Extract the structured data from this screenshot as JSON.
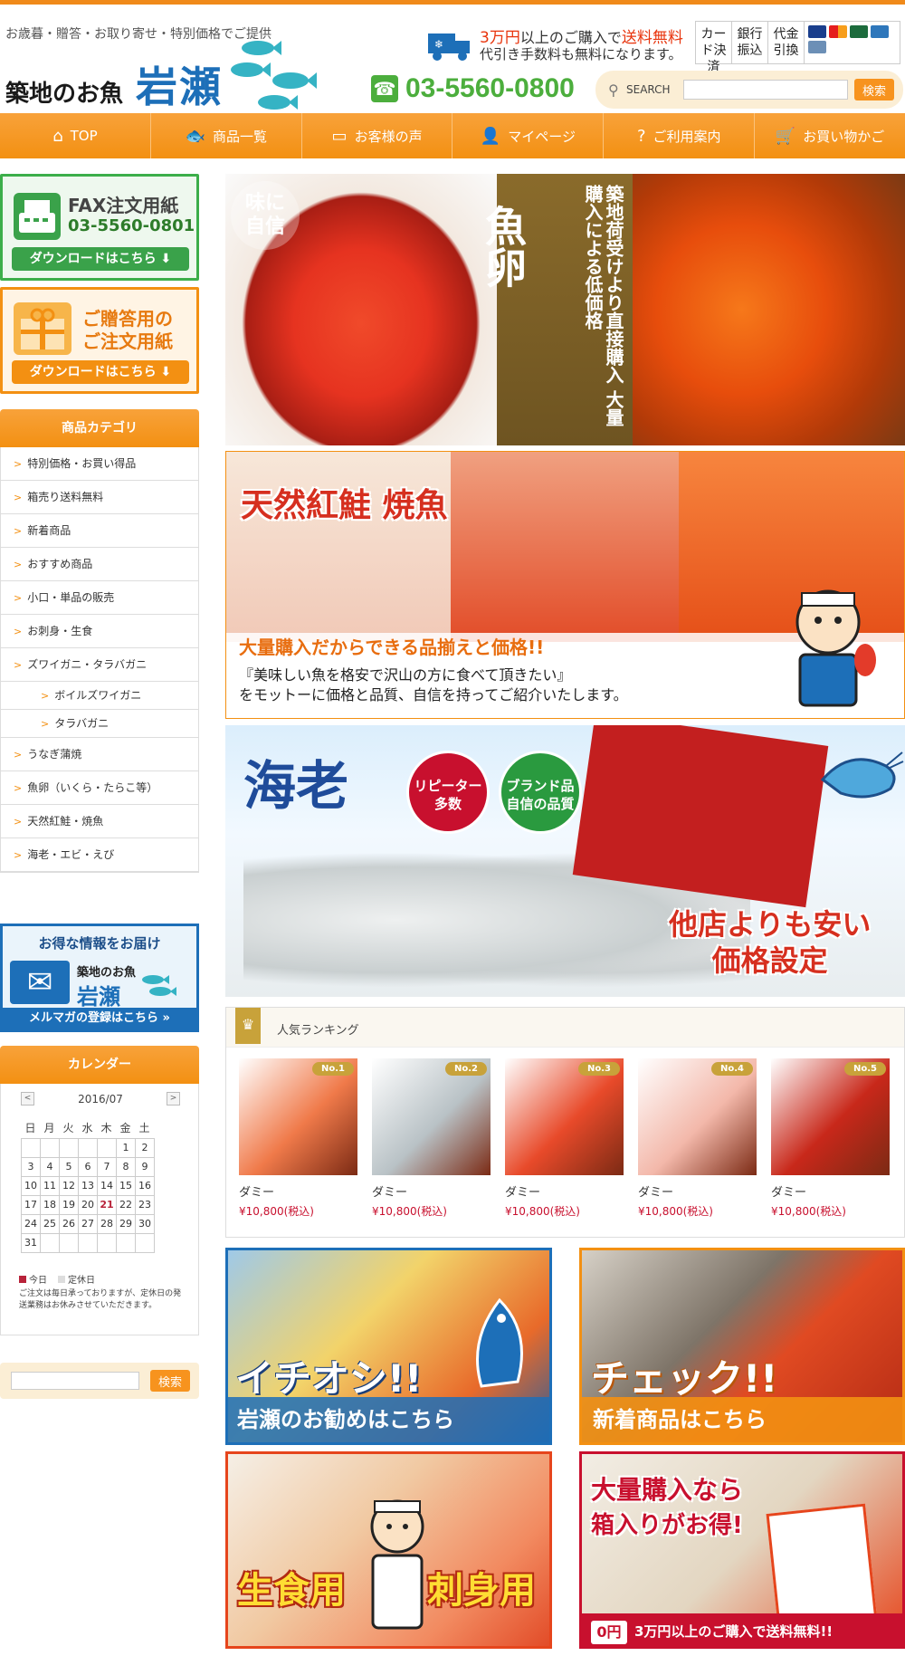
{
  "header": {
    "tagline": "お歳暮・贈答・お取り寄せ・特別価格でご提供",
    "logo_small": "築地のお魚",
    "logo_big": "岩瀬",
    "shipping_amount": "3万円",
    "shipping_mid": "以上のご購入で",
    "shipping_free": "送料無料",
    "shipping_line2": "代引き手数料も無料になります。",
    "payment": [
      "カード決済",
      "銀行振込",
      "代金引換"
    ],
    "phone": "03-5560-0800",
    "search_label": "SEARCH",
    "search_placeholder": "",
    "search_button": "検索"
  },
  "nav": [
    {
      "label": "TOP",
      "icon": "⌂"
    },
    {
      "label": "商品一覧",
      "icon": "🐟"
    },
    {
      "label": "お客様の声",
      "icon": "▭"
    },
    {
      "label": "マイページ",
      "icon": "👤"
    },
    {
      "label": "ご利用案内",
      "icon": "?"
    },
    {
      "label": "お買い物かご",
      "icon": "🛒"
    }
  ],
  "sidebar": {
    "fax_title": "FAX注文用紙",
    "fax_number": "03-5560-0801",
    "fax_download": "ダウンロードはこちら ⬇",
    "gift_title_1": "ご贈答用の",
    "gift_title_2": "ご注文用紙",
    "gift_download": "ダウンロードはこちら ⬇",
    "category_heading": "商品カテゴリ",
    "categories": [
      "特別価格・お買い得品",
      "箱売り送料無料",
      "新着商品",
      "おすすめ商品",
      "小口・単品の販売",
      "お刺身・生食",
      "ズワイガニ・タラバガニ",
      "ボイルズワイガニ",
      "タラバガニ",
      "うなぎ蒲焼",
      "魚卵（いくら・たらこ等）",
      "天然紅鮭・焼魚",
      "海老・エビ・えび"
    ],
    "mail_top": "お得な情報をお届け",
    "mail_name_small": "築地のお魚",
    "mail_name_big": "岩瀬",
    "mail_bottom": "メルマガの登録はこちら »",
    "calendar_heading": "カレンダー",
    "calendar_month": "2016/07",
    "calendar_dow": [
      "日",
      "月",
      "火",
      "水",
      "木",
      "金",
      "土"
    ],
    "calendar_days": [
      "",
      "",
      "",
      "",
      "",
      "1",
      "2",
      "3",
      "4",
      "5",
      "6",
      "7",
      "8",
      "9",
      "10",
      "11",
      "12",
      "13",
      "14",
      "15",
      "16",
      "17",
      "18",
      "19",
      "20",
      "21",
      "22",
      "23",
      "24",
      "25",
      "26",
      "27",
      "28",
      "29",
      "30",
      "31",
      "",
      "",
      "",
      "",
      "",
      ""
    ],
    "calendar_today": "21",
    "legend_today": "今日",
    "legend_holiday": "定休日",
    "calendar_note": "ご注文は毎日承っておりますが、定休日の発送業務はお休みさせていただきます。",
    "search_button": "検索"
  },
  "banners": {
    "b1_aji_1": "味に",
    "b1_aji_2": "自信",
    "b1_gyoran": "魚卵",
    "b1_sub": "築地荷受けより直接購入 大量購入による低価格",
    "b2_title": "天然紅鮭 焼魚",
    "b2_catch": "大量購入だからできる品揃えと価格!!",
    "b2_text_1": "『美味しい魚を格安で沢山の方に食べて頂きたい』",
    "b2_text_2": "をモットーに価格と品質、自信を持ってご紹介いたします。",
    "b3_title": "海老",
    "b3_badge1_1": "リピーター",
    "b3_badge1_2": "多数",
    "b3_badge2_1": "ブランド品",
    "b3_badge2_2": "自信の品質",
    "b3_catch_1": "他店よりも安い",
    "b3_catch_2": "価格設定"
  },
  "ranking": {
    "title": "人気ランキング",
    "items": [
      {
        "no": "No.1",
        "name": "ダミー",
        "price": "¥10,800(税込)",
        "color": "#f07a4a"
      },
      {
        "no": "No.2",
        "name": "ダミー",
        "price": "¥10,800(税込)",
        "color": "#b9c2c6"
      },
      {
        "no": "No.3",
        "name": "ダミー",
        "price": "¥10,800(税込)",
        "color": "#e84a2a"
      },
      {
        "no": "No.4",
        "name": "ダミー",
        "price": "¥10,800(税込)",
        "color": "#f3b8aa"
      },
      {
        "no": "No.5",
        "name": "ダミー",
        "price": "¥10,800(税込)",
        "color": "#c8281a"
      }
    ]
  },
  "promos": {
    "p1_big": "イチオシ!!",
    "p1_sub": "岩瀬のお勧めはこちら",
    "p2_big": "チェック!!",
    "p2_sub": "新着商品はこちら",
    "p3_left": "生食用",
    "p3_right": "刺身用",
    "p4_l1": "大量購入なら",
    "p4_l2": "箱入りがお得!",
    "p4_bottom": "3万円以上のご購入で送料無料!!",
    "p4_truck": "0円"
  }
}
